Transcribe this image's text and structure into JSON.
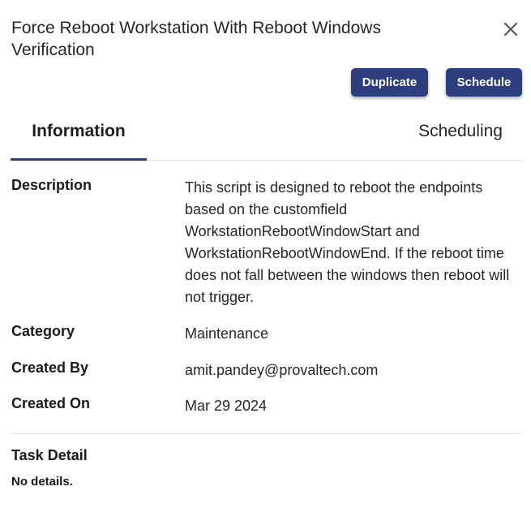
{
  "dialog": {
    "title": "Force Reboot Workstation With Reboot Windows Verification",
    "close_icon": "close-icon"
  },
  "actions": {
    "duplicate_label": "Duplicate",
    "schedule_label": "Schedule",
    "button_color": "#2c3e7e"
  },
  "tabs": [
    {
      "label": "Information",
      "active": true
    },
    {
      "label": "Scheduling",
      "active": false
    }
  ],
  "details": {
    "description_label": "Description",
    "description_value": "This script is designed to reboot the endpoints based on the customfield WorkstationRebootWindowStart and WorkstationRebootWindowEnd. If the reboot time does not fall between the windows then reboot will not trigger.",
    "category_label": "Category",
    "category_value": "Maintenance",
    "created_by_label": "Created By",
    "created_by_value": "amit.pandey@provaltech.com",
    "created_on_label": "Created On",
    "created_on_value": "Mar 29 2024"
  },
  "task": {
    "title": "Task Detail",
    "body": "No details."
  }
}
